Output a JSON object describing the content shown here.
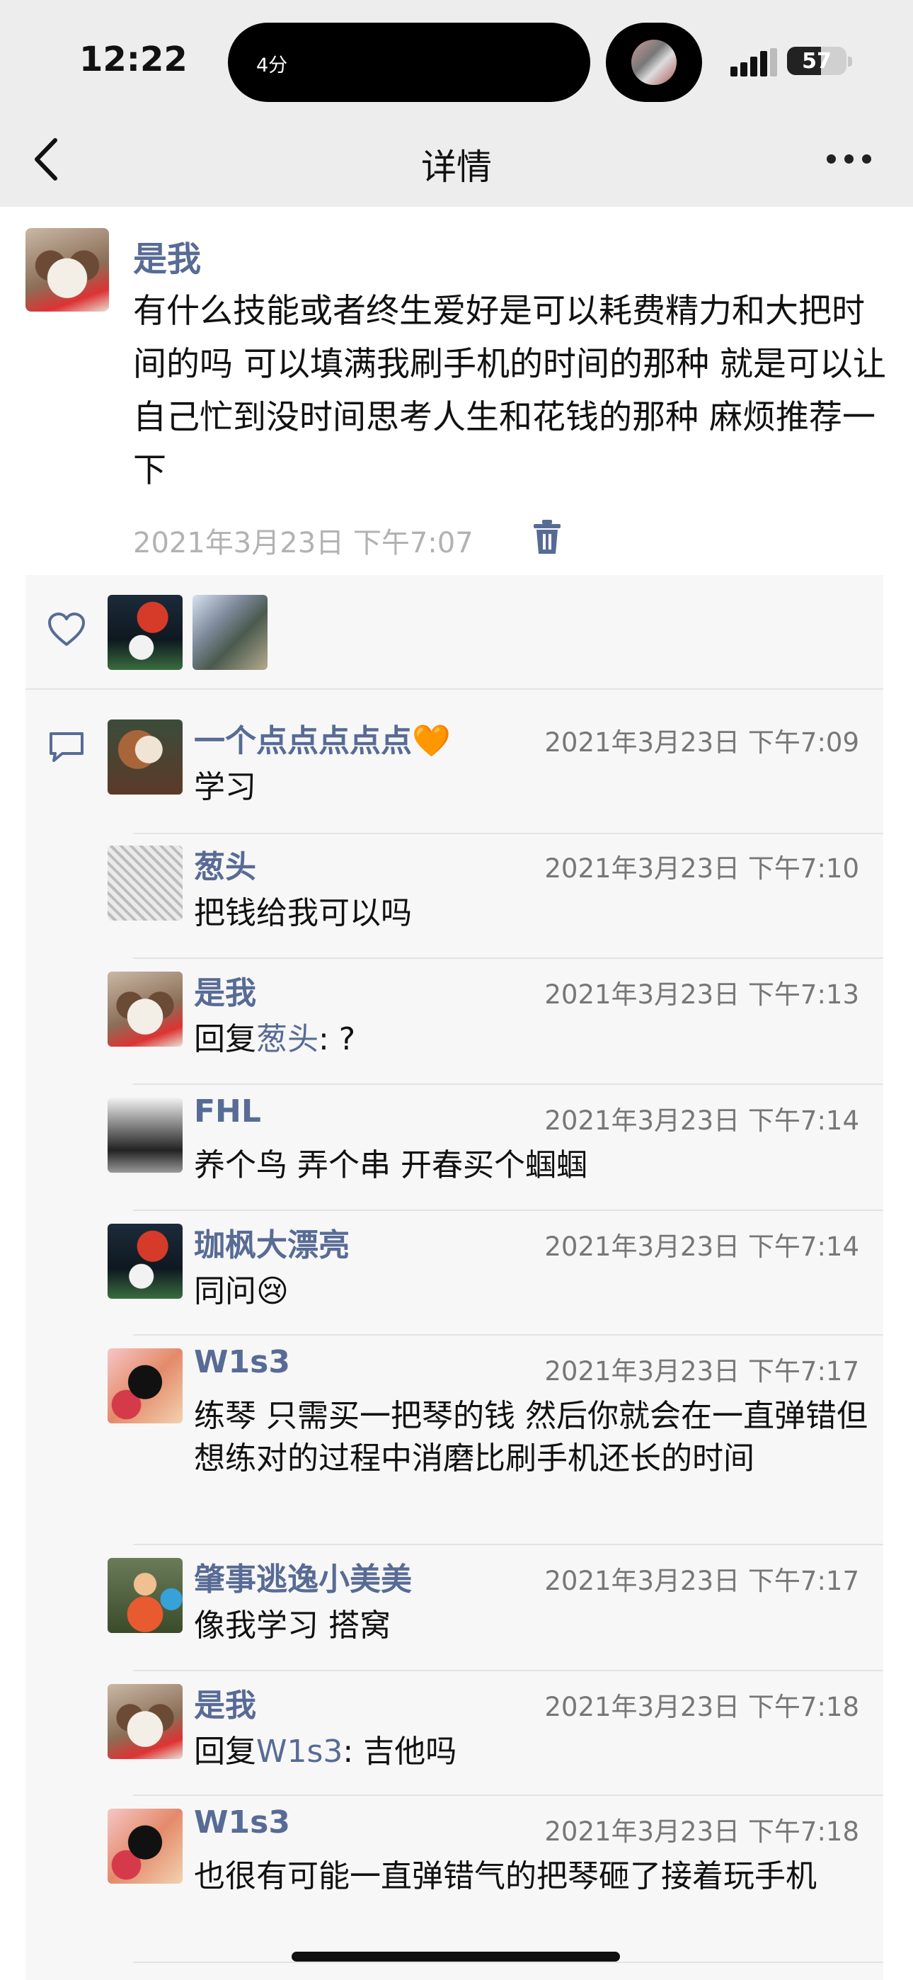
{
  "status_bar": {
    "time": "12:22",
    "island_text": "4分",
    "battery": "57",
    "battery_level": 0.57
  },
  "nav": {
    "title": "详情"
  },
  "post": {
    "author": "是我",
    "text": "有什么技能或者终生爱好是可以耗费精力和大把时间的吗 可以填满我刷手机的时间的那种 就是可以让自己忙到没时间思考人生和花钱的那种 麻烦推荐一下",
    "time": "2021年3月23日 下午7:07"
  },
  "comments": [
    {
      "name": "一个点点点点点🧡",
      "time": "2021年3月23日 下午7:09",
      "text": "学习"
    },
    {
      "name": "葱头",
      "time": "2021年3月23日 下午7:10",
      "text": "把钱给我可以吗"
    },
    {
      "name": "是我",
      "time": "2021年3月23日 下午7:13",
      "reply_prefix": "回复",
      "reply_to": "葱头",
      "text": ": ?"
    },
    {
      "name": "FHL",
      "time": "2021年3月23日 下午7:14",
      "text": "养个鸟 弄个串 开春买个蝈蝈"
    },
    {
      "name": "珈枫大漂亮",
      "time": "2021年3月23日 下午7:14",
      "text": "同问😢"
    },
    {
      "name": "W1s3",
      "time": "2021年3月23日 下午7:17",
      "text": "练琴 只需买一把琴的钱 然后你就会在一直弹错但想练对的过程中消磨比刷手机还长的时间"
    },
    {
      "name": "肇事逃逸小美美",
      "time": "2021年3月23日 下午7:17",
      "text": "像我学习 搭窝"
    },
    {
      "name": "是我",
      "time": "2021年3月23日 下午7:18",
      "reply_prefix": "回复",
      "reply_to": "W1s3",
      "text": ": 吉他吗"
    },
    {
      "name": "W1s3",
      "time": "2021年3月23日 下午7:18",
      "text": "也很有可能一直弹错气的把琴砸了接着玩手机"
    }
  ],
  "colors": {
    "link": "#576b95",
    "panel": "#f7f7f7",
    "topbar": "#ededed"
  },
  "icons": [
    "back-icon",
    "more-icon",
    "delete-icon",
    "heart-icon",
    "comment-icon",
    "signal-icon",
    "battery-icon"
  ]
}
